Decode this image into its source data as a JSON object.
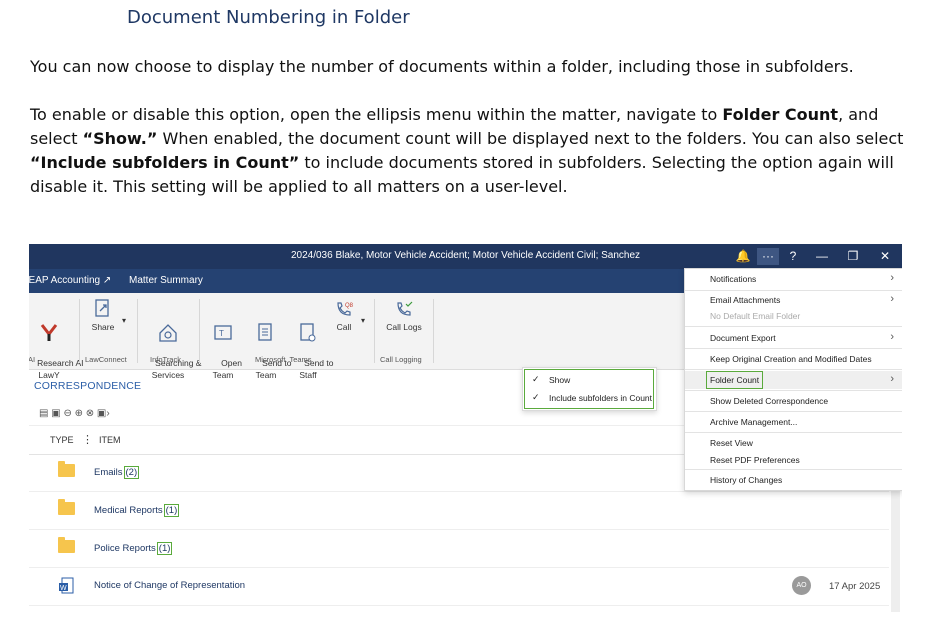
{
  "doc": {
    "heading": "Document Numbering in Folder",
    "para1": "You can now choose to display the number of documents within a folder, including those in subfolders.",
    "para2": {
      "t1": "To enable or disable this option, open the ellipsis menu within the matter, navigate to ",
      "b1": "Folder Count",
      "t2": ", and select ",
      "b2": "“Show.”",
      "t3": " When enabled, the document count will be displayed next to the folders. You can also select ",
      "b3": "“Include subfolders in Count”",
      "t4": " to include documents stored in subfolders. Selecting the option again will disable it. This setting will be applied to all matters on a user-level."
    }
  },
  "app": {
    "title": "2024/036 Blake, Motor Vehicle Accident; Motor Vehicle Accident Civil; Sanchez",
    "controls": {
      "bell": "🔔",
      "more": "···",
      "help": "?",
      "min": "—",
      "restore": "❐",
      "close": "✕"
    },
    "nav": {
      "leap": "LEAP Accounting ↗",
      "summary": "Matter Summary"
    },
    "ribbon": {
      "research": "Research AI\nLawY",
      "share": "Share",
      "searching": "Searching &\nServices",
      "open_team": "Open\nTeam",
      "send_team": "Send to\nTeam",
      "send_staff": "Send to\nStaff",
      "call": "Call",
      "call_logs": "Call Logs",
      "groups": {
        "ai": "AI",
        "lawconnect": "LawConnect",
        "infotrack": "InfoTrack",
        "msteams": "Microsoft  Teams",
        "calllog": "Call Logging"
      }
    },
    "section": "CORRESPONDENCE",
    "toolbar_icons": "▤ ▣ ⊖ ⊕ ⊗   ▣›",
    "columns": {
      "type": "TYPE",
      "item": "ITEM"
    },
    "rows": [
      {
        "name": "Emails",
        "count": "(2)"
      },
      {
        "name": "Medical Reports",
        "count": "(1)"
      },
      {
        "name": "Police Reports",
        "count": "(1)"
      },
      {
        "name": "Notice of Change of Representation",
        "avatar": "AO",
        "date": "17 Apr 2025"
      }
    ],
    "menu": [
      {
        "label": "Notifications",
        "arrow": "›"
      },
      {
        "label": "Email Attachments",
        "arrow": "›"
      },
      {
        "label": "No Default Email Folder"
      },
      {
        "label": "Document Export",
        "arrow": "›"
      },
      {
        "label": "Keep Original Creation and Modified Dates"
      },
      {
        "label": "Folder Count",
        "arrow": "›"
      },
      {
        "label": "Show Deleted Correspondence"
      },
      {
        "label": "Archive Management..."
      },
      {
        "label": "Reset View"
      },
      {
        "label": "Reset PDF Preferences"
      },
      {
        "label": "History of Changes"
      }
    ],
    "submenu": [
      {
        "label": "Show",
        "check": "✓"
      },
      {
        "label": "Include subfolders in Count",
        "check": "✓"
      }
    ],
    "colors": {
      "titlebar": "#20365f",
      "navbar": "#254272",
      "highlight": "#5aaa3c",
      "folder": "#f6c54d"
    }
  }
}
